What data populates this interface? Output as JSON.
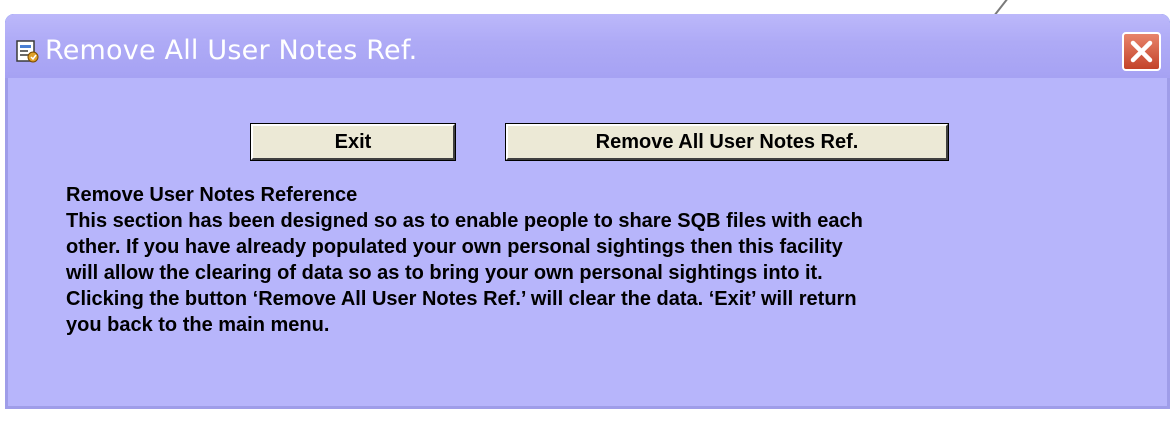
{
  "window": {
    "title": "Remove All User Notes Ref.",
    "close_label": "×"
  },
  "buttons": {
    "exit_label": "Exit",
    "remove_label": "Remove All User Notes Ref."
  },
  "description": {
    "heading": "Remove User Notes Reference",
    "lines": [
      "This section has been designed so as to enable people to share SQB files with each",
      "other. If you have already populated your own personal sightings then this facility",
      "will allow the clearing of data so as to bring your own personal sightings into it.",
      "Clicking the button ‘Remove All User Notes Ref.’ will clear the data. ‘Exit’ will return",
      "you back to the main menu."
    ]
  },
  "icons": {
    "title_icon": "form-document-icon",
    "close_icon": "close-icon"
  },
  "colors": {
    "titlebar": "#aeaaf6",
    "client_background": "#b7b5fb",
    "button_face": "#ece9d6",
    "close_button": "#d65a40"
  }
}
